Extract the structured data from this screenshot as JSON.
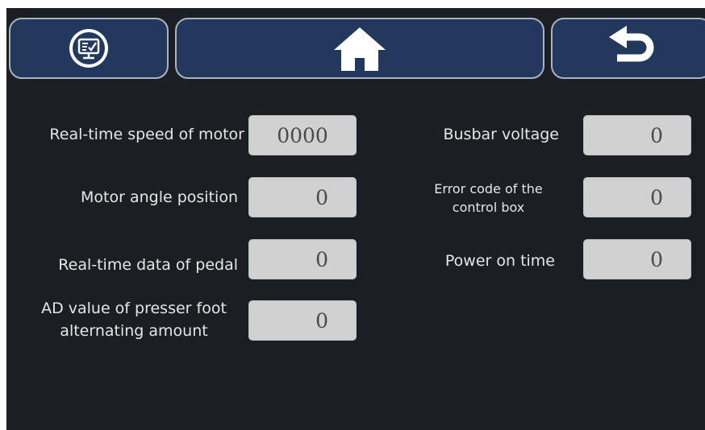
{
  "header": {
    "monitor_icon": "monitor-check-icon",
    "home_icon": "home-icon",
    "back_icon": "back-arrow-icon"
  },
  "left": [
    {
      "label_lines": [
        "Real-time speed of motor"
      ],
      "value": "0000"
    },
    {
      "label_lines": [
        "Motor angle position"
      ],
      "value": "0"
    },
    {
      "label_lines": [
        "Real-time data of pedal"
      ],
      "value": "0"
    },
    {
      "label_lines": [
        "AD value of presser foot",
        "alternating amount"
      ],
      "value": "0"
    }
  ],
  "right": [
    {
      "label_lines": [
        "Busbar voltage"
      ],
      "value": "0"
    },
    {
      "label_lines": [
        "Error code of the",
        "control box"
      ],
      "value": "0"
    },
    {
      "label_lines": [
        "Power on time"
      ],
      "value": "0"
    }
  ],
  "colors": {
    "background": "#1b1f23",
    "button_fill": "#22395d",
    "button_border": "#aab3c2",
    "value_box": "#d1d1d1",
    "label_text": "#e6e6e6"
  }
}
